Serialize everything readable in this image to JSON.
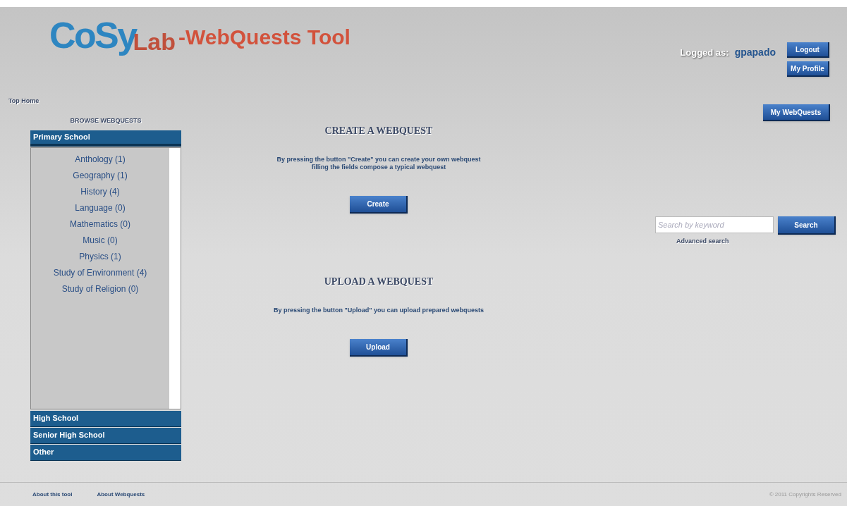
{
  "header": {
    "logo": {
      "part_1": "CoSy",
      "part_2": "Lab"
    },
    "title": "-WebQuests Tool",
    "logged_label": "Logged as:",
    "username": "gpapado",
    "buttons": [
      "Logout",
      "My Profile"
    ]
  },
  "breadcrumb": "Top Home",
  "sidebar": {
    "heading": "BROWSE WEBQUESTS",
    "categories": [
      {
        "label": "Primary School",
        "expanded": true,
        "items": [
          "Anthology (1)",
          "Geography (1)",
          "History (4)",
          "Language (0)",
          "Mathematics (0)",
          "Music (0)",
          "Physics (1)",
          "Study of Environment (4)",
          "Study of Religion (0)"
        ]
      },
      {
        "label": "High School",
        "expanded": false
      },
      {
        "label": "Senior High School",
        "expanded": false
      },
      {
        "label": "Other",
        "expanded": false
      }
    ]
  },
  "sections": [
    {
      "heading": "CREATE A WEBQUEST",
      "text": "By pressing the button \"Create\" you can create your own webquest filling the fields compose a typical webquest",
      "button": "Create"
    },
    {
      "heading": "UPLOAD A WEBQUEST",
      "text": "By pressing the button \"Upload\" you can upload prepared webquests",
      "button": "Upload"
    }
  ],
  "my_webquests_button": "My WebQuests",
  "search": {
    "placeholder": "Search by keyword",
    "button": "Search",
    "advanced_link": "Advanced search"
  },
  "footer": {
    "links": [
      "About this tool",
      "About Webquests"
    ],
    "copyright": "© 2011 Copyrights Reserved"
  }
}
